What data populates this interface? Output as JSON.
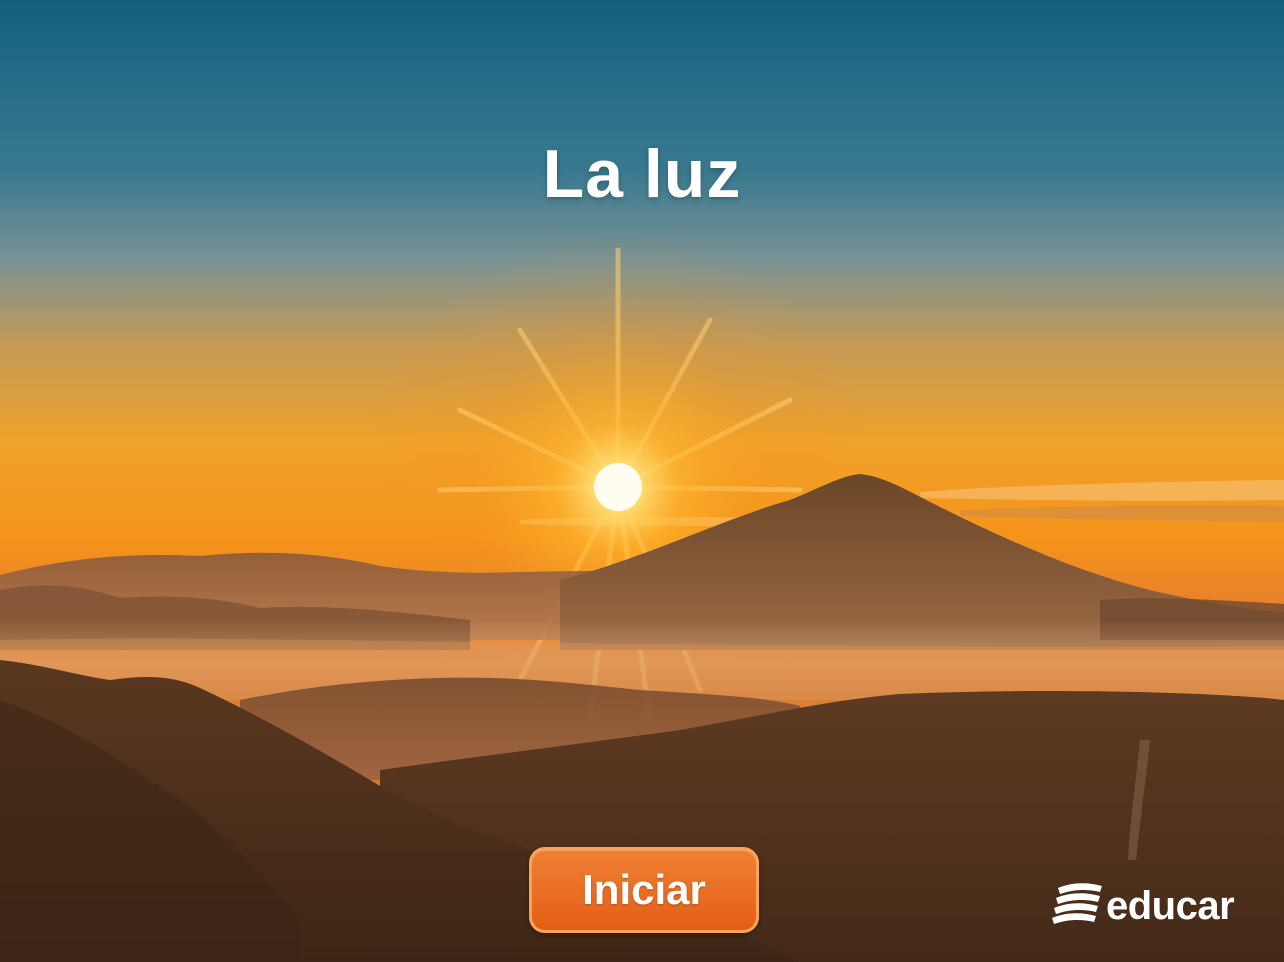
{
  "slide": {
    "title": "La luz"
  },
  "controls": {
    "start_label": "Iniciar"
  },
  "branding": {
    "logo_text": "educar"
  },
  "colors": {
    "sky_top": "#1c5f7c",
    "sky_horizon": "#f39a1e",
    "sun": "#fff6d8",
    "button": "#e8691f",
    "button_border": "#f7a35c",
    "mountains": "#5a3a22"
  }
}
